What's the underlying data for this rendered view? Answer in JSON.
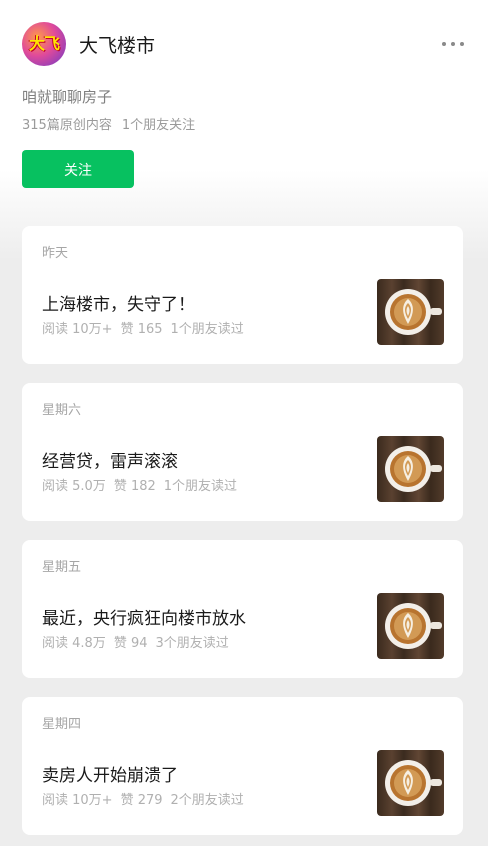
{
  "account": {
    "avatar_text": "大飞",
    "name": "大飞楼市",
    "description": "咱就聊聊房子",
    "stats": {
      "articles": "315篇原创内容",
      "friends": "1个朋友关注"
    },
    "follow_label": "关注"
  },
  "icons": {
    "more": "more-dots-icon",
    "thumbnail": "latte-art-coffee-image"
  },
  "colors": {
    "follow_button": "#07c160",
    "background": "#ededed",
    "card": "#ffffff"
  },
  "articles": [
    {
      "date": "昨天",
      "title": "上海楼市，失守了！",
      "reads": "阅读 10万+",
      "likes": "赞 165",
      "friends_read": "1个朋友读过"
    },
    {
      "date": "星期六",
      "title": "经营贷，雷声滚滚",
      "reads": "阅读 5.0万",
      "likes": "赞 182",
      "friends_read": "1个朋友读过"
    },
    {
      "date": "星期五",
      "title": "最近，央行疯狂向楼市放水",
      "reads": "阅读 4.8万",
      "likes": "赞 94",
      "friends_read": "3个朋友读过"
    },
    {
      "date": "星期四",
      "title": "卖房人开始崩溃了",
      "reads": "阅读 10万+",
      "likes": "赞 279",
      "friends_read": "2个朋友读过"
    }
  ]
}
